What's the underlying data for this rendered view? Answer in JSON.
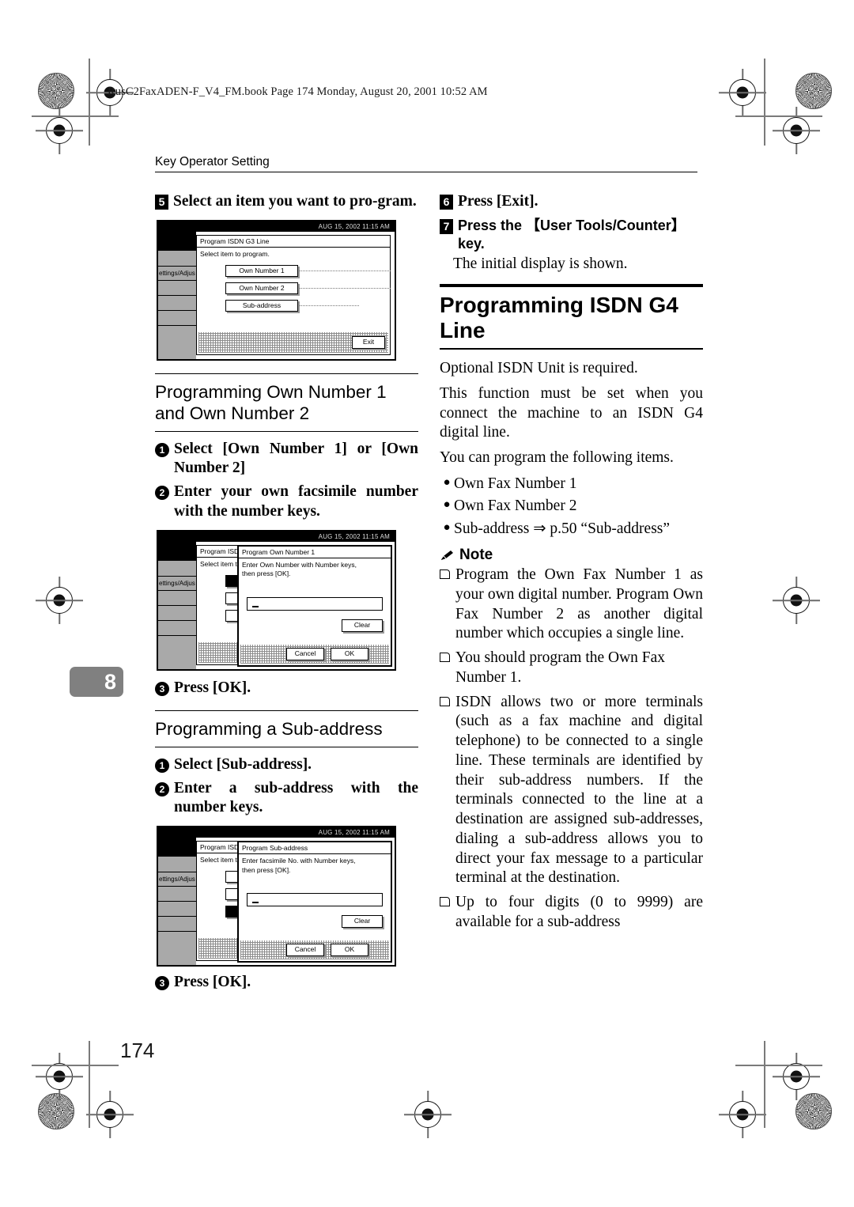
{
  "file_header": "RusC2FaxADEN-F_V4_FM.book  Page 174  Monday, August 20, 2001  10:52 AM",
  "running_head": "Key Operator Setting",
  "chapter_tab": "8",
  "folio": "174",
  "left_column": {
    "step5": {
      "num": "5",
      "text": "Select an item you want to pro-gram."
    },
    "lcd1": {
      "status": "AUG 15, 2002  11:15 AM",
      "sidebar_label": "ettings/Adjus",
      "window_title": "Program ISDN G3 Line",
      "window_sub": "Select item to program.",
      "buttons": [
        "Own Number 1",
        "Own Number 2",
        "Sub-address"
      ],
      "exit_label": "Exit"
    },
    "section1_head": "Programming Own Number 1 and Own Number 2",
    "sub1": {
      "num": "1",
      "text": "Select [Own Number 1] or [Own Number 2]"
    },
    "sub2": {
      "num": "2",
      "text": "Enter your own facsimile number with the number keys."
    },
    "lcd2": {
      "status": "AUG 15, 2002  11:15 AM",
      "sidebar_label": "ettings/Adjus",
      "bg_title": "Program ISDN G",
      "bg_sub": "Select item to p",
      "dialog_title": "Program Own Number  1",
      "dialog_msg_line1": "Enter Own Number with Number keys,",
      "dialog_msg_line2": "then press [OK].",
      "clear_label": "Clear",
      "cancel_label": "Cancel",
      "ok_label": "OK"
    },
    "sub3": {
      "num": "3",
      "text": "Press [OK]."
    },
    "section2_head": "Programming a Sub-address",
    "sub4": {
      "num": "1",
      "text": "Select [Sub-address]."
    },
    "sub5": {
      "num": "2",
      "text": "Enter a sub-address with the number keys."
    },
    "lcd3": {
      "status": "AUG 15, 2002  11:15 AM",
      "sidebar_label": "ettings/Adjus",
      "bg_title": "Program ISDN G",
      "bg_sub": "Select item to p",
      "dialog_title": "Program Sub-address",
      "dialog_msg_line1": "Enter facsimile No. with Number keys,",
      "dialog_msg_line2": "then press [OK].",
      "clear_label": "Clear",
      "cancel_label": "Cancel",
      "ok_label": "OK"
    },
    "sub6": {
      "num": "3",
      "text": "Press [OK]."
    }
  },
  "right_column": {
    "step6": {
      "num": "6",
      "text": "Press [Exit]."
    },
    "step7": {
      "num": "7",
      "text": "Press the 【User Tools/Counter】 key."
    },
    "step7_note": "The initial display is shown.",
    "big_head": "Programming ISDN G4 Line",
    "para1": "Optional ISDN Unit is required.",
    "para2": "This function must be set when you connect the machine to an ISDN G4 digital line.",
    "para3": "You can program the following items.",
    "bullets": [
      "Own Fax Number 1",
      "Own Fax Number 2",
      "Sub-address ⇒ p.50 “Sub-address”"
    ],
    "note_label": "Note",
    "notes": [
      "Program the Own Fax Number 1 as your own digital number. Program Own Fax Number 2 as another digital number which occupies a single line.",
      "You should program the Own Fax Number 1.",
      "ISDN allows two or more terminals (such as a fax machine and digital telephone) to be connected to a single line. These terminals are identified by their sub-address numbers. If the terminals connected to the line at a destination are assigned sub-addresses, dialing a sub-address allows you to direct your fax message to a particular terminal at the destination.",
      "Up to four digits (0 to 9999) are available for a sub-address"
    ]
  }
}
